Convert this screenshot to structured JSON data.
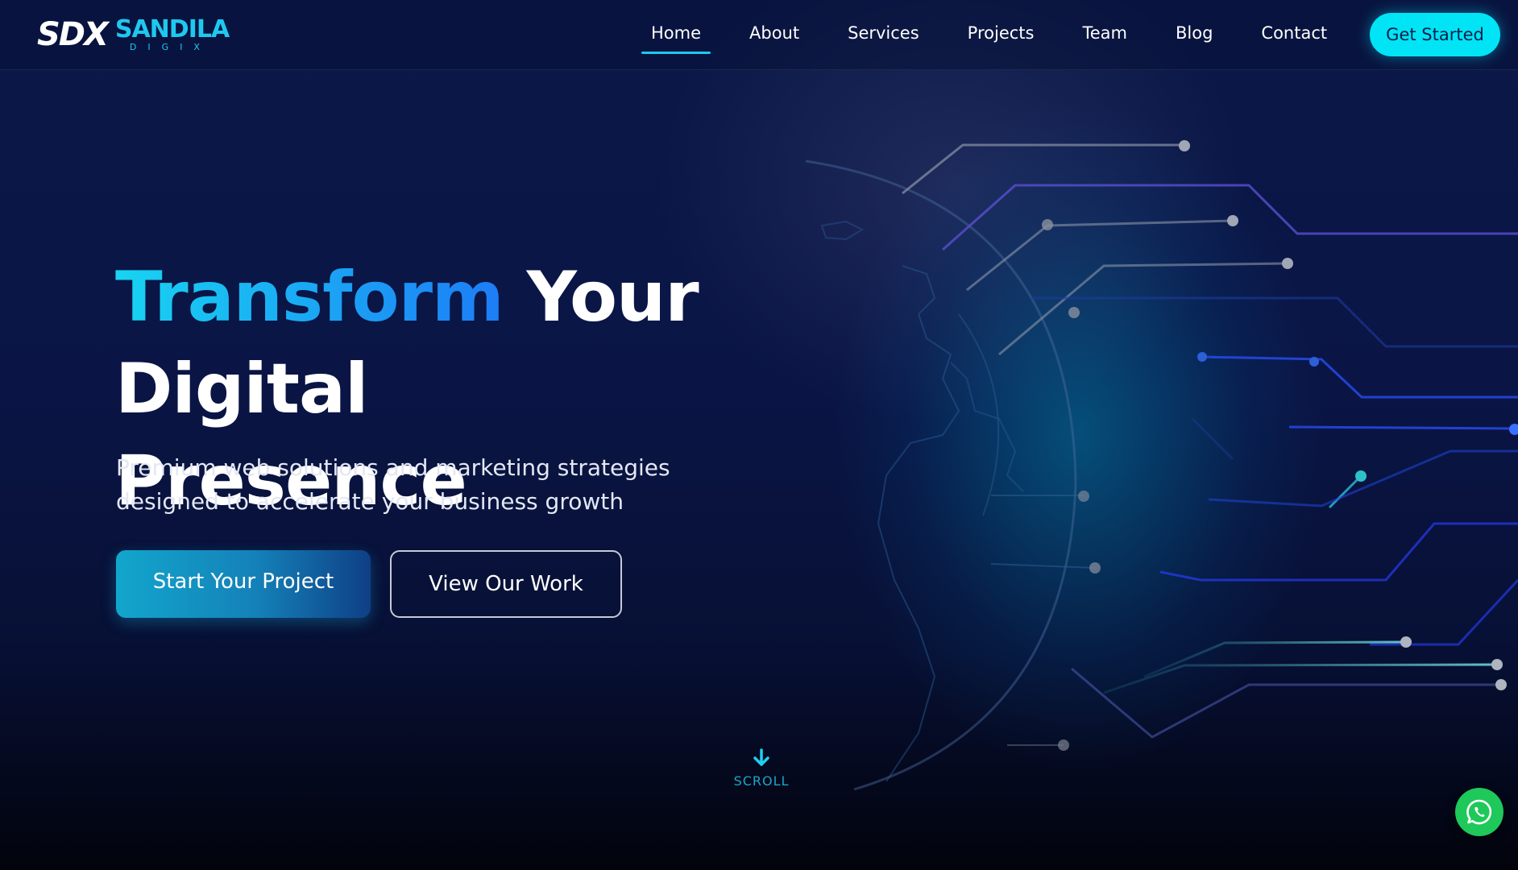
{
  "brand": {
    "mark": "SDX",
    "name": "SANDILA",
    "sub": "DIGIX"
  },
  "nav": {
    "items": [
      {
        "label": "Home",
        "active": true
      },
      {
        "label": "About"
      },
      {
        "label": "Services"
      },
      {
        "label": "Projects"
      },
      {
        "label": "Team"
      },
      {
        "label": "Blog"
      },
      {
        "label": "Contact"
      }
    ],
    "cta": "Get Started"
  },
  "hero": {
    "title_accent": "Transform",
    "title_rest": "Your Digital",
    "title_line2": "Presence",
    "subtitle": "Premium web solutions and marketing strategies designed to accelerate your business growth",
    "primary_button": "Start Your Project",
    "secondary_button": "View Our Work"
  },
  "scroll": {
    "label": "SCROLL"
  },
  "icons": {
    "scroll": "arrow-down-icon",
    "chat": "whatsapp-icon"
  },
  "colors": {
    "accent": "#1ec8f0",
    "cta": "#00e4f6",
    "whatsapp": "#1fc85a",
    "background": "#0a1545"
  }
}
